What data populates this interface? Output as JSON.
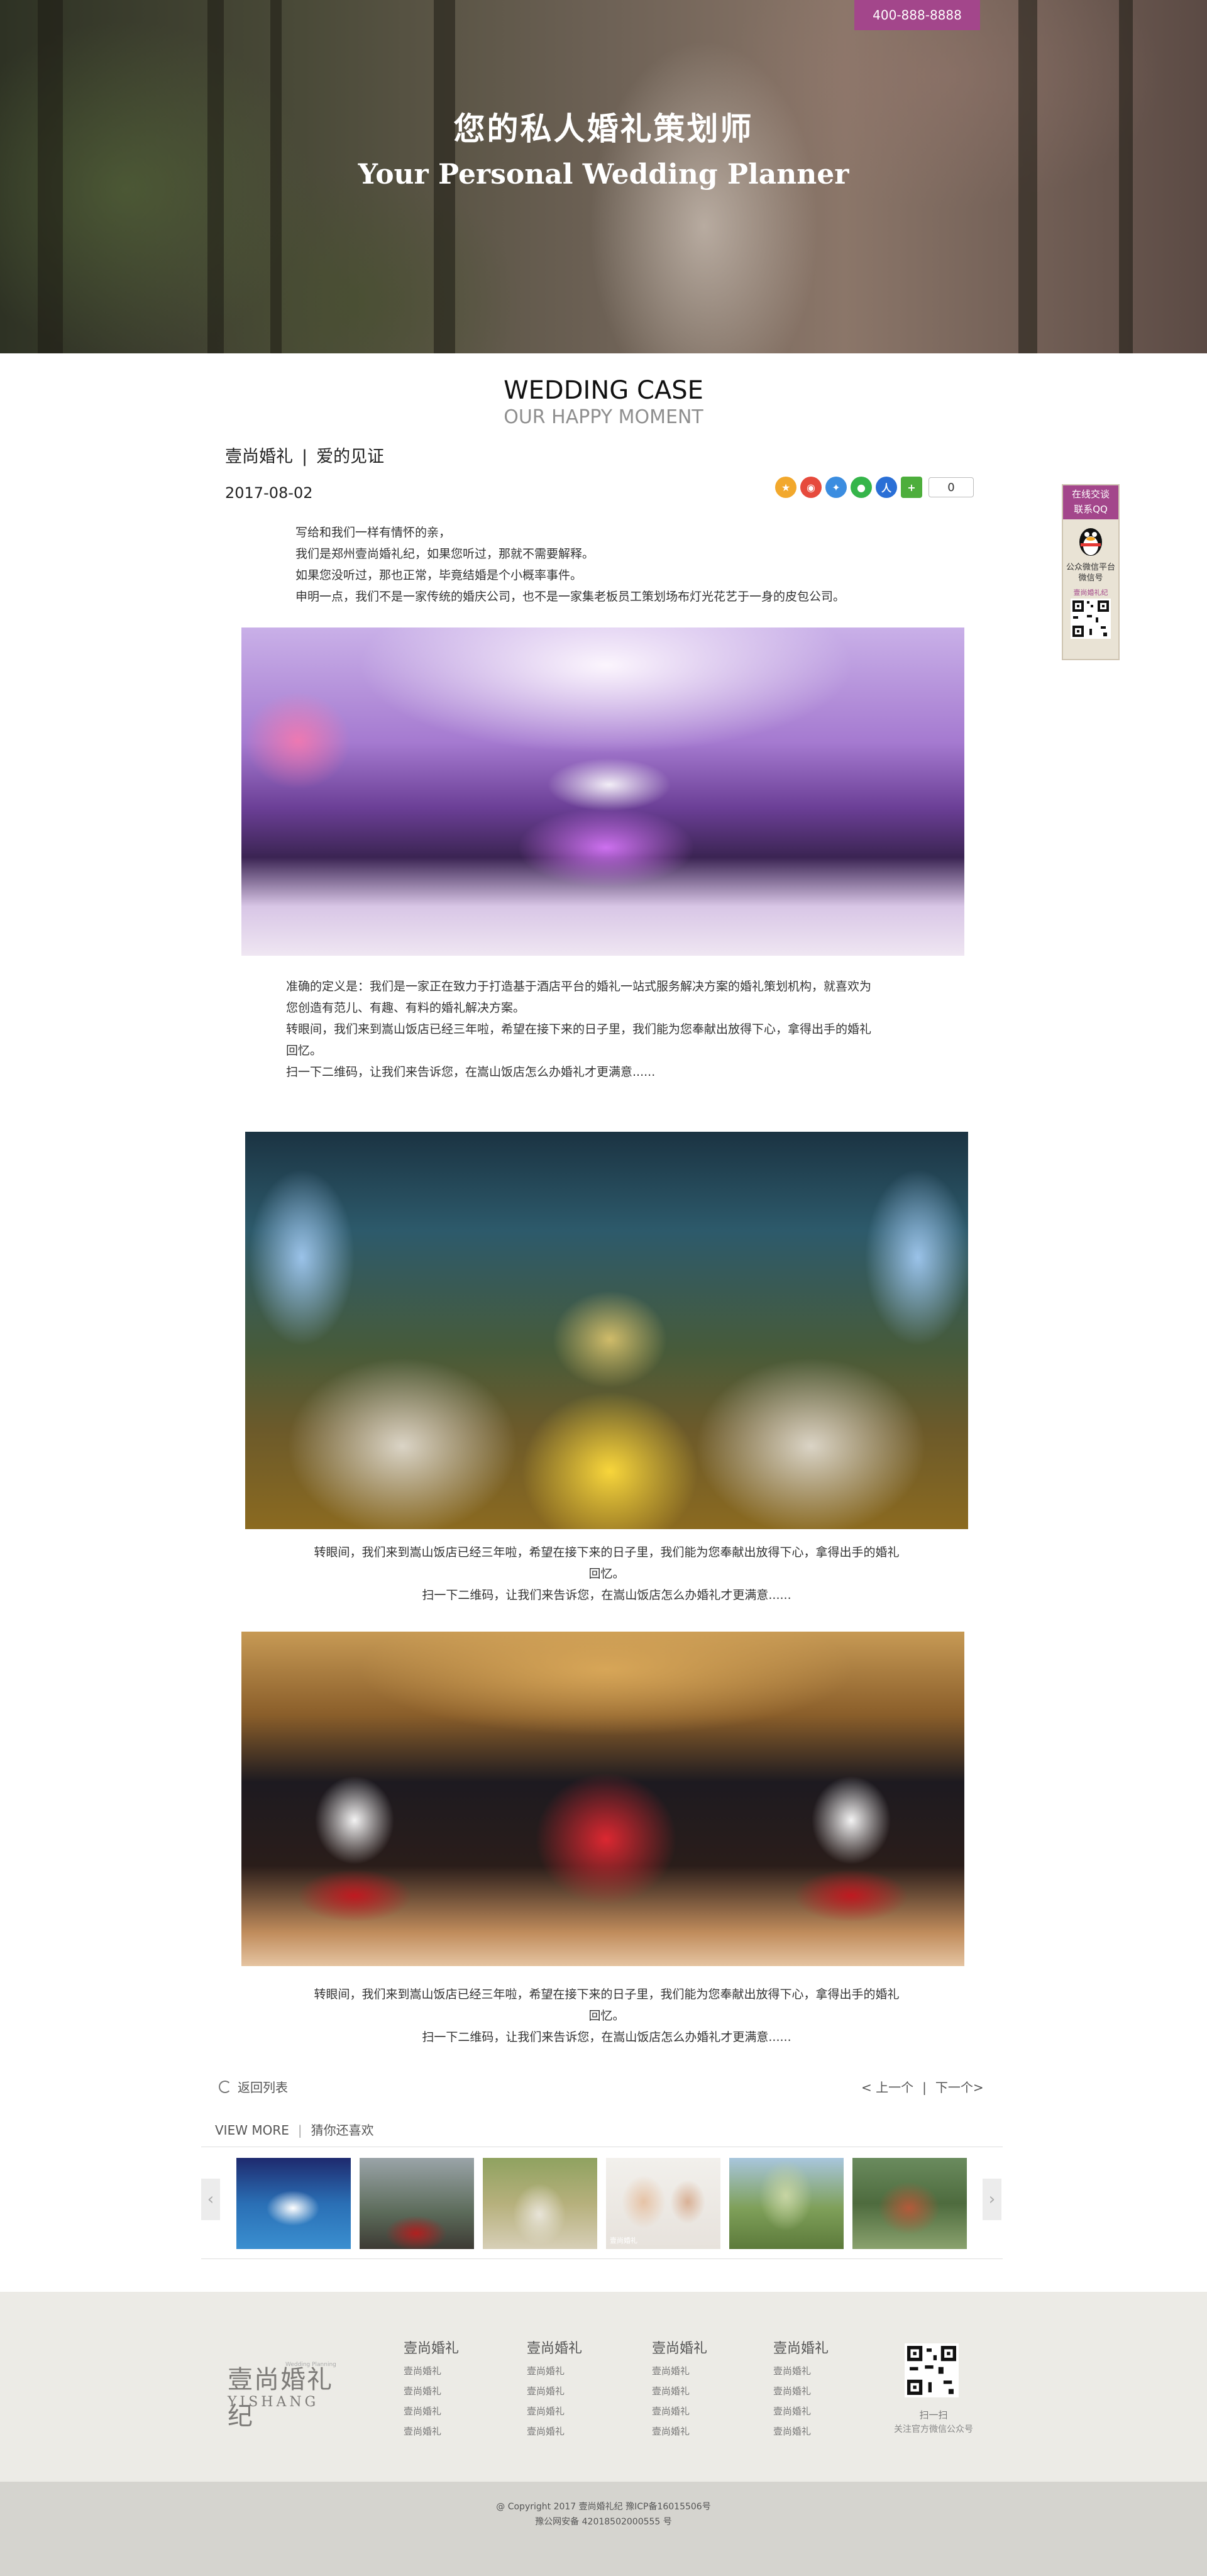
{
  "header": {
    "phone": "400-888-8888",
    "title_cn": "您的私人婚礼策划师",
    "title_en": "Your Personal Wedding Planner"
  },
  "section": {
    "title": "WEDDING CASE",
    "subtitle": "OUR HAPPY MOMENT"
  },
  "breadcrumb": {
    "brand": "壹尚婚礼",
    "separator": "|",
    "page": "爱的见证"
  },
  "post": {
    "date": "2017-08-02",
    "intro": [
      "写给和我们一样有情怀的亲，",
      "我们是郑州壹尚婚礼纪，如果您听过，那就不需要解释。",
      "如果您没听过，那也正常，毕竟结婚是个小概率事件。",
      "申明一点，我们不是一家传统的婚庆公司，也不是一家集老板员工策划场布灯光花艺于一身的皮包公司。"
    ],
    "body": [
      "准确的定义是：我们是一家正在致力于打造基于酒店平台的婚礼一站式服务解决方案的婚礼策划机构，就喜欢为",
      "您创造有范儿、有趣、有料的婚礼解决方案。",
      "转眼间，我们来到嵩山饭店已经三年啦，希望在接下来的日子里，我们能为您奉献出放得下心，拿得出手的婚礼",
      "回忆。",
      "扫一下二维码，让我们来告诉您，在嵩山饭店怎么办婚礼才更满意......"
    ],
    "caption_2": [
      "转眼间，我们来到嵩山饭店已经三年啦，希望在接下来的日子里，我们能为您奉献出放得下心，拿得出手的婚礼",
      "回忆。",
      "扫一下二维码，让我们来告诉您，在嵩山饭店怎么办婚礼才更满意......"
    ],
    "caption_3": [
      "转眼间，我们来到嵩山饭店已经三年啦，希望在接下来的日子里，我们能为您奉献出放得下心，拿得出手的婚礼",
      "回忆。",
      "扫一下二维码，让我们来告诉您，在嵩山饭店怎么办婚礼才更满意......"
    ]
  },
  "share": {
    "count": "0",
    "icons": [
      "qzone-icon",
      "weibo-icon",
      "tencent-weibo-icon",
      "wechat-icon",
      "renren-icon",
      "more-share-icon"
    ],
    "colors": [
      "#f2a82c",
      "#e64a3c",
      "#3b8de0",
      "#35b54a",
      "#2a6fd6",
      "#4dae3c"
    ]
  },
  "side_widget": {
    "top_line_1": "在线交谈",
    "top_line_2": "联系QQ",
    "label_1": "公众微信平台",
    "label_2": "微信号",
    "brand": "壹尚婚礼纪"
  },
  "pager": {
    "back": "返回列表",
    "prev": "< 上一个",
    "separator": "|",
    "next": "下一个>"
  },
  "more": {
    "view_more": "VIEW MORE",
    "separator": "|",
    "guess": "猜你还喜欢"
  },
  "carousel": {
    "prev": "‹",
    "next": "›",
    "thumb_4_label": "壹尚婚礼"
  },
  "footer": {
    "logo_cn": "壹尚婚礼纪",
    "logo_tag": "Wedding Planning",
    "logo_en": "YISHANG",
    "columns": [
      {
        "title": "壹尚婚礼",
        "links": [
          "壹尚婚礼",
          "壹尚婚礼",
          "壹尚婚礼",
          "壹尚婚礼"
        ]
      },
      {
        "title": "壹尚婚礼",
        "links": [
          "壹尚婚礼",
          "壹尚婚礼",
          "壹尚婚礼",
          "壹尚婚礼"
        ]
      },
      {
        "title": "壹尚婚礼",
        "links": [
          "壹尚婚礼",
          "壹尚婚礼",
          "壹尚婚礼",
          "壹尚婚礼"
        ]
      },
      {
        "title": "壹尚婚礼",
        "links": [
          "壹尚婚礼",
          "壹尚婚礼",
          "壹尚婚礼",
          "壹尚婚礼"
        ]
      }
    ],
    "qr_caption_1": "扫一扫",
    "qr_caption_2": "关注官方微信公众号",
    "copyright_1": "@ Copyright 2017 壹尚婚礼纪 豫ICP备16015506号",
    "copyright_2": "豫公网安备 42018502000555 号"
  },
  "colors": {
    "accent": "#a3468b",
    "footer_bg": "#ecebe6",
    "copyright_bg": "#d5d4cf"
  }
}
